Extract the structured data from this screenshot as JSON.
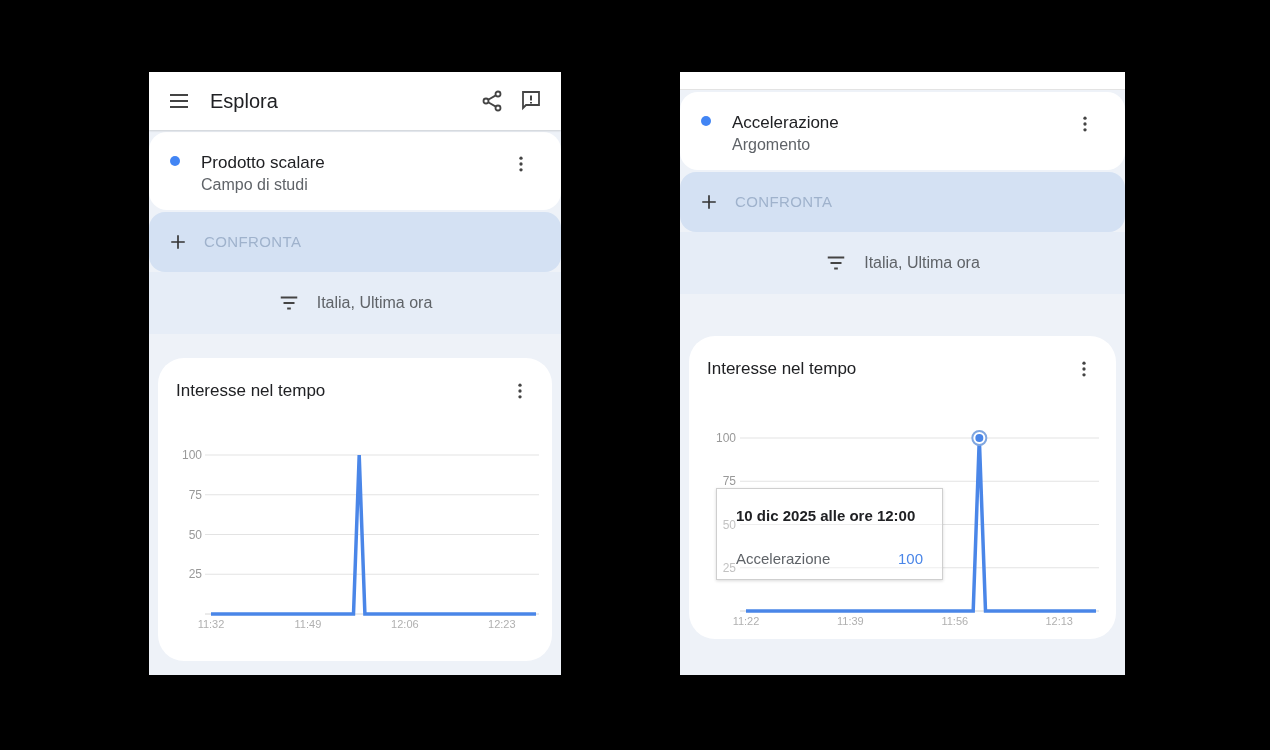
{
  "panels": [
    {
      "header": {
        "title": "Esplora"
      },
      "topic": {
        "name": "Prodotto scalare",
        "type": "Campo di studi",
        "color": "#4285f4"
      },
      "compare": {
        "label": "CONFRONTA"
      },
      "filter": {
        "label": "Italia, Ultima ora"
      },
      "chart_card": {
        "title": "Interesse nel tempo",
        "chart_data": {
          "type": "line",
          "grid": true,
          "ylim": [
            0,
            100
          ],
          "yticks": [
            25,
            50,
            75,
            100
          ],
          "categories": [
            "11:32",
            null,
            null,
            null,
            null,
            null,
            null,
            null,
            null,
            null,
            null,
            null,
            null,
            null,
            null,
            null,
            null,
            "11:49",
            null,
            null,
            null,
            null,
            null,
            null,
            null,
            null,
            null,
            null,
            null,
            null,
            null,
            null,
            null,
            null,
            "12:06",
            null,
            null,
            null,
            null,
            null,
            null,
            null,
            null,
            null,
            null,
            null,
            null,
            null,
            null,
            null,
            null,
            "12:23",
            null,
            null,
            null,
            null,
            null,
            null
          ],
          "series": [
            {
              "color": "#4a86e8",
              "values": [
                0,
                0,
                0,
                0,
                0,
                0,
                0,
                0,
                0,
                0,
                0,
                0,
                0,
                0,
                0,
                0,
                0,
                0,
                0,
                0,
                0,
                0,
                0,
                0,
                0,
                0,
                100,
                0,
                0,
                0,
                0,
                0,
                0,
                0,
                0,
                0,
                0,
                0,
                0,
                0,
                0,
                0,
                0,
                0,
                0,
                0,
                0,
                0,
                0,
                0,
                0,
                0,
                0,
                0,
                0,
                0,
                0,
                0
              ]
            }
          ]
        }
      }
    },
    {
      "topic": {
        "name": "Accelerazione",
        "type": "Argomento",
        "color": "#4285f4"
      },
      "compare": {
        "label": "CONFRONTA"
      },
      "filter": {
        "label": "Italia, Ultima ora"
      },
      "chart_card": {
        "title": "Interesse nel tempo",
        "chart_data": {
          "type": "line",
          "grid": true,
          "ylim": [
            0,
            100
          ],
          "yticks": [
            25,
            50,
            75,
            100
          ],
          "categories": [
            "11:22",
            null,
            null,
            null,
            null,
            null,
            null,
            null,
            null,
            null,
            null,
            null,
            null,
            null,
            null,
            null,
            null,
            "11:39",
            null,
            null,
            null,
            null,
            null,
            null,
            null,
            null,
            null,
            null,
            null,
            null,
            null,
            null,
            null,
            null,
            "11:56",
            null,
            null,
            null,
            null,
            null,
            null,
            null,
            null,
            null,
            null,
            null,
            null,
            null,
            null,
            null,
            null,
            "12:13",
            null,
            null,
            null,
            null,
            null,
            null
          ],
          "series": [
            {
              "name": "Accelerazione",
              "color": "#4a86e8",
              "values": [
                0,
                0,
                0,
                0,
                0,
                0,
                0,
                0,
                0,
                0,
                0,
                0,
                0,
                0,
                0,
                0,
                0,
                0,
                0,
                0,
                0,
                0,
                0,
                0,
                0,
                0,
                0,
                0,
                0,
                0,
                0,
                0,
                0,
                0,
                0,
                0,
                0,
                0,
                100,
                0,
                0,
                0,
                0,
                0,
                0,
                0,
                0,
                0,
                0,
                0,
                0,
                0,
                0,
                0,
                0,
                0,
                0,
                0
              ]
            }
          ]
        },
        "tooltip": {
          "title": "10 dic 2025 alle ore 12:00",
          "value": "100"
        }
      }
    }
  ]
}
